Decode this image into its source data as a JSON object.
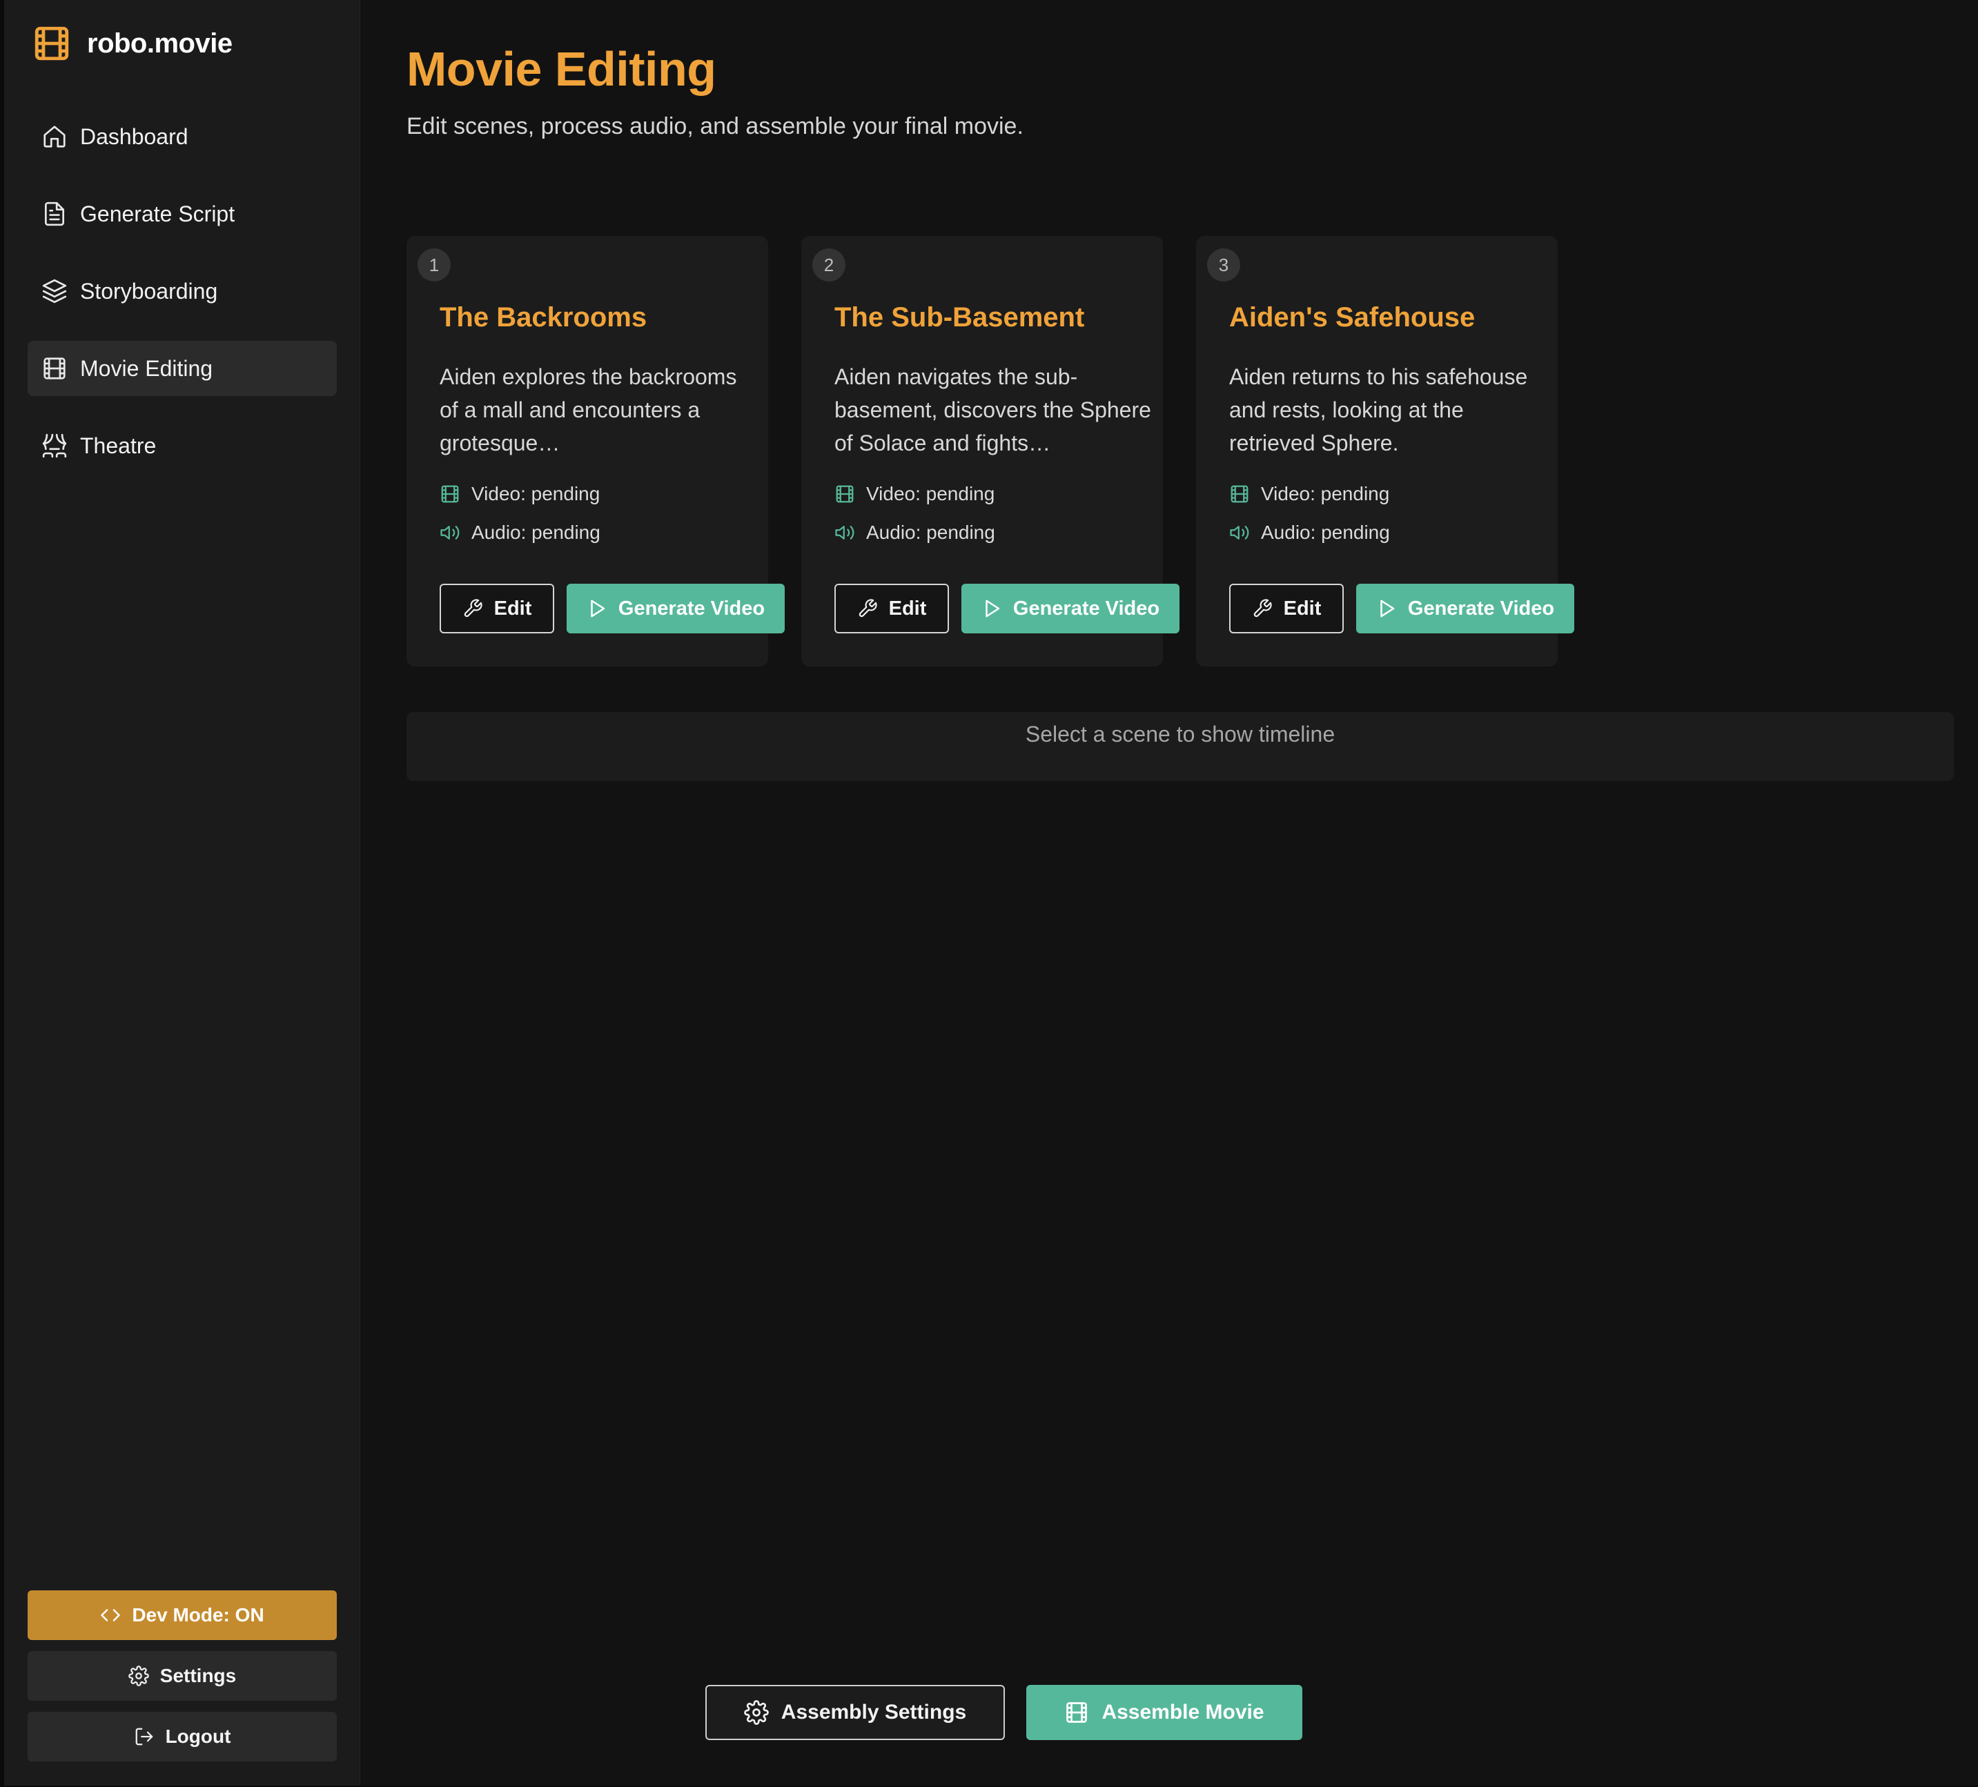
{
  "app": {
    "name": "robo.movie",
    "logo_icon": "film-icon"
  },
  "colors": {
    "accent_orange": "#f0a33a",
    "accent_teal": "#56b89a",
    "dev_mode_bg": "#c48b2e"
  },
  "sidebar": {
    "items": [
      {
        "label": "Dashboard",
        "icon": "home-icon"
      },
      {
        "label": "Generate Script",
        "icon": "file-text-icon"
      },
      {
        "label": "Storyboarding",
        "icon": "layers-icon"
      },
      {
        "label": "Movie Editing",
        "icon": "film-icon",
        "active": true
      },
      {
        "label": "Theatre",
        "icon": "theatre-icon"
      }
    ],
    "dev_mode_label": "Dev Mode: ON",
    "settings_label": "Settings",
    "logout_label": "Logout"
  },
  "page": {
    "title": "Movie Editing",
    "subtitle": "Edit scenes, process audio, and assemble your final movie."
  },
  "scenes": [
    {
      "number": "1",
      "title": "The Backrooms",
      "description": "Aiden explores the backrooms of a mall and encounters a grotesque…",
      "video_status": "Video: pending",
      "audio_status": "Audio: pending",
      "edit_label": "Edit",
      "generate_label": "Generate Video"
    },
    {
      "number": "2",
      "title": "The Sub-Basement",
      "description": "Aiden navigates the sub-basement, discovers the Sphere of Solace and fights…",
      "video_status": "Video: pending",
      "audio_status": "Audio: pending",
      "edit_label": "Edit",
      "generate_label": "Generate Video"
    },
    {
      "number": "3",
      "title": "Aiden's Safehouse",
      "description": "Aiden returns to his safehouse and rests, looking at the retrieved Sphere.",
      "video_status": "Video: pending",
      "audio_status": "Audio: pending",
      "edit_label": "Edit",
      "generate_label": "Generate Video"
    }
  ],
  "timeline": {
    "placeholder": "Select a scene to show timeline"
  },
  "footer": {
    "assembly_settings_label": "Assembly Settings",
    "assemble_label": "Assemble Movie"
  }
}
